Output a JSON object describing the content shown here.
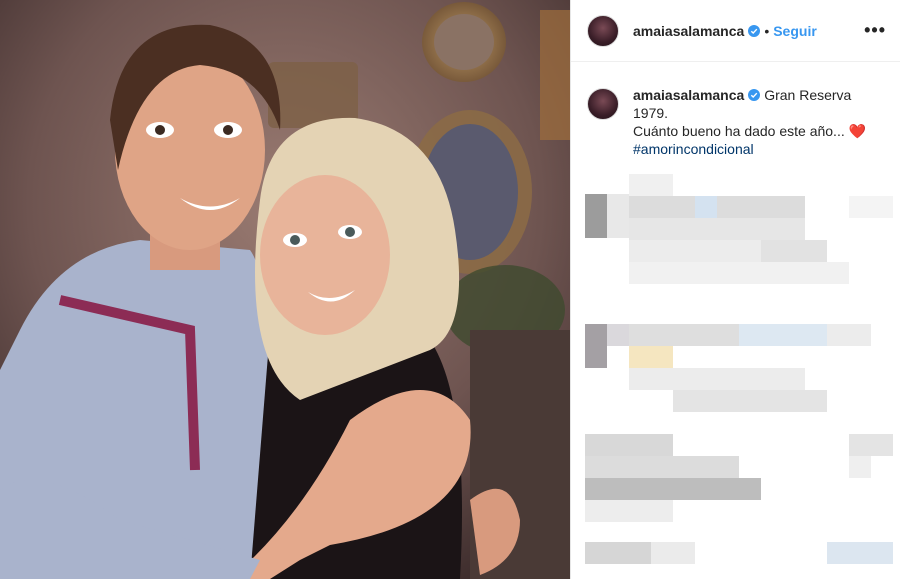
{
  "post": {
    "username": "amaiasalamanca",
    "follow_label": "Seguir",
    "separator": "•",
    "more_label": "•••"
  },
  "caption": {
    "username": "amaiasalamanca",
    "line1": "Gran Reserva",
    "line2": "1979.",
    "line3": "Cuánto bueno ha dado este año...",
    "emoji": "❤️",
    "hashtag": "#amorincondicional"
  },
  "colors": {
    "accent": "#3897f0",
    "verified": "#3897f0",
    "hashtag": "#003569",
    "text": "#262626"
  },
  "icons": {
    "verified": "verified-badge-icon",
    "more": "more-options-icon"
  }
}
